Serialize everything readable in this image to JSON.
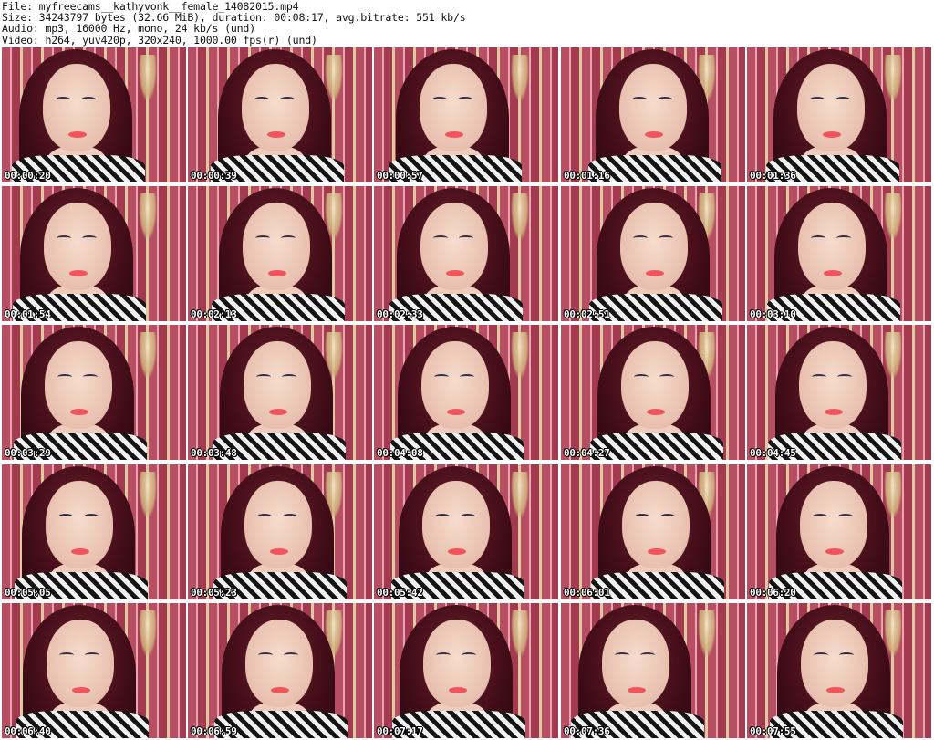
{
  "header": {
    "file_line": "File: myfreecams__kathyvonk__female_14082015.mp4",
    "size_line": "Size: 34243797 bytes (32.66 MiB), duration: 00:08:17, avg.bitrate: 551 kb/s",
    "audio_line": "Audio: mp3, 16000 Hz, mono, 24 kb/s (und)",
    "video_line": "Video: h264, yuv420p, 320x240, 1000.00 fps(r) (und)"
  },
  "thumbnails": [
    {
      "timestamp": "00:00:20"
    },
    {
      "timestamp": "00:00:39"
    },
    {
      "timestamp": "00:00:57"
    },
    {
      "timestamp": "00:01:16"
    },
    {
      "timestamp": "00:01:36"
    },
    {
      "timestamp": "00:01:54"
    },
    {
      "timestamp": "00:02:13"
    },
    {
      "timestamp": "00:02:33"
    },
    {
      "timestamp": "00:02:51"
    },
    {
      "timestamp": "00:03:10"
    },
    {
      "timestamp": "00:03:29"
    },
    {
      "timestamp": "00:03:48"
    },
    {
      "timestamp": "00:04:08"
    },
    {
      "timestamp": "00:04:27"
    },
    {
      "timestamp": "00:04:45"
    },
    {
      "timestamp": "00:05:05"
    },
    {
      "timestamp": "00:05:23"
    },
    {
      "timestamp": "00:05:42"
    },
    {
      "timestamp": "00:06:01"
    },
    {
      "timestamp": "00:06:20"
    },
    {
      "timestamp": "00:06:40"
    },
    {
      "timestamp": "00:06:59"
    },
    {
      "timestamp": "00:07:17"
    },
    {
      "timestamp": "00:07:36"
    },
    {
      "timestamp": "00:07:55"
    }
  ]
}
